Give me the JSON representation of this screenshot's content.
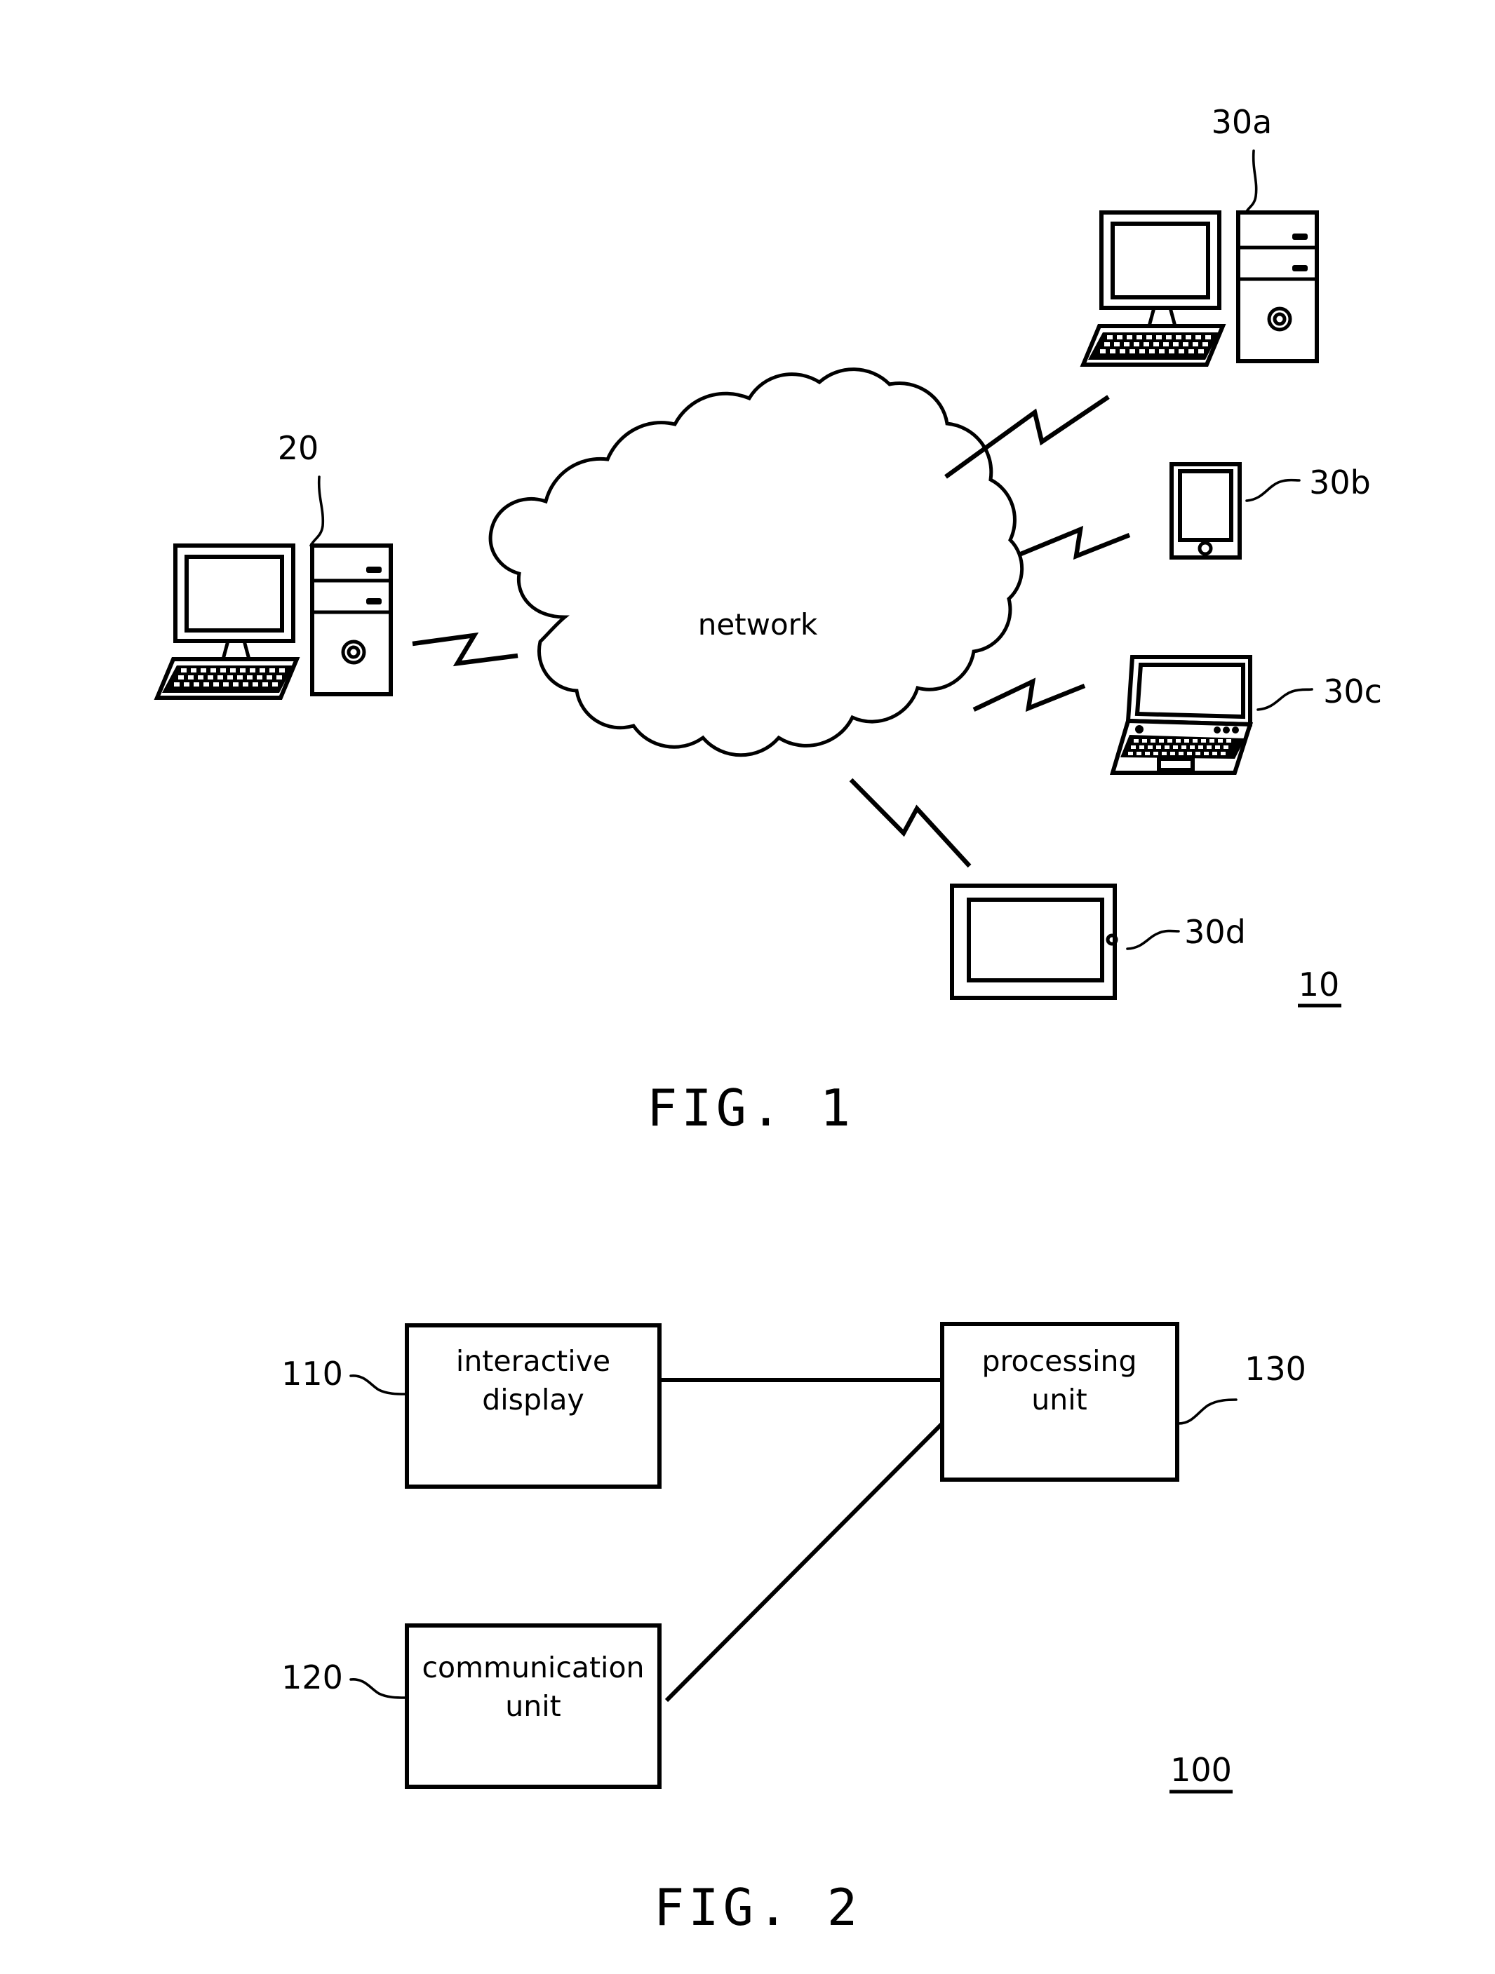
{
  "document": {
    "kind": "patent-drawing-sheet",
    "background_color": "#ffffff",
    "ink_color": "#000000"
  },
  "figure1": {
    "caption": "FIG. 1",
    "system_reference": "10",
    "cloud_label": "network",
    "nodes": [
      {
        "id": "20",
        "reference": "20",
        "device": "desktop-computer",
        "label": "20"
      },
      {
        "id": "30a",
        "reference": "30a",
        "device": "desktop-computer",
        "label": "30a"
      },
      {
        "id": "30b",
        "reference": "30b",
        "device": "smartphone",
        "label": "30b"
      },
      {
        "id": "30c",
        "reference": "30c",
        "device": "laptop-computer",
        "label": "30c"
      },
      {
        "id": "30d",
        "reference": "30d",
        "device": "tablet",
        "label": "30d"
      }
    ],
    "links": [
      {
        "from": "20",
        "to": "network",
        "style": "lightning-bolt"
      },
      {
        "from": "network",
        "to": "30a",
        "style": "lightning-bolt"
      },
      {
        "from": "network",
        "to": "30b",
        "style": "lightning-bolt"
      },
      {
        "from": "network",
        "to": "30c",
        "style": "lightning-bolt"
      },
      {
        "from": "network",
        "to": "30d",
        "style": "lightning-bolt"
      }
    ]
  },
  "figure2": {
    "caption": "FIG. 2",
    "system_reference": "100",
    "blocks": [
      {
        "reference": "110",
        "line1": "interactive",
        "line2": "display"
      },
      {
        "reference": "120",
        "line1": "communication",
        "line2": "unit"
      },
      {
        "reference": "130",
        "line1": "processing",
        "line2": "unit"
      }
    ],
    "connections": [
      {
        "from": "110",
        "to": "130"
      },
      {
        "from": "120",
        "to": "130"
      }
    ]
  }
}
